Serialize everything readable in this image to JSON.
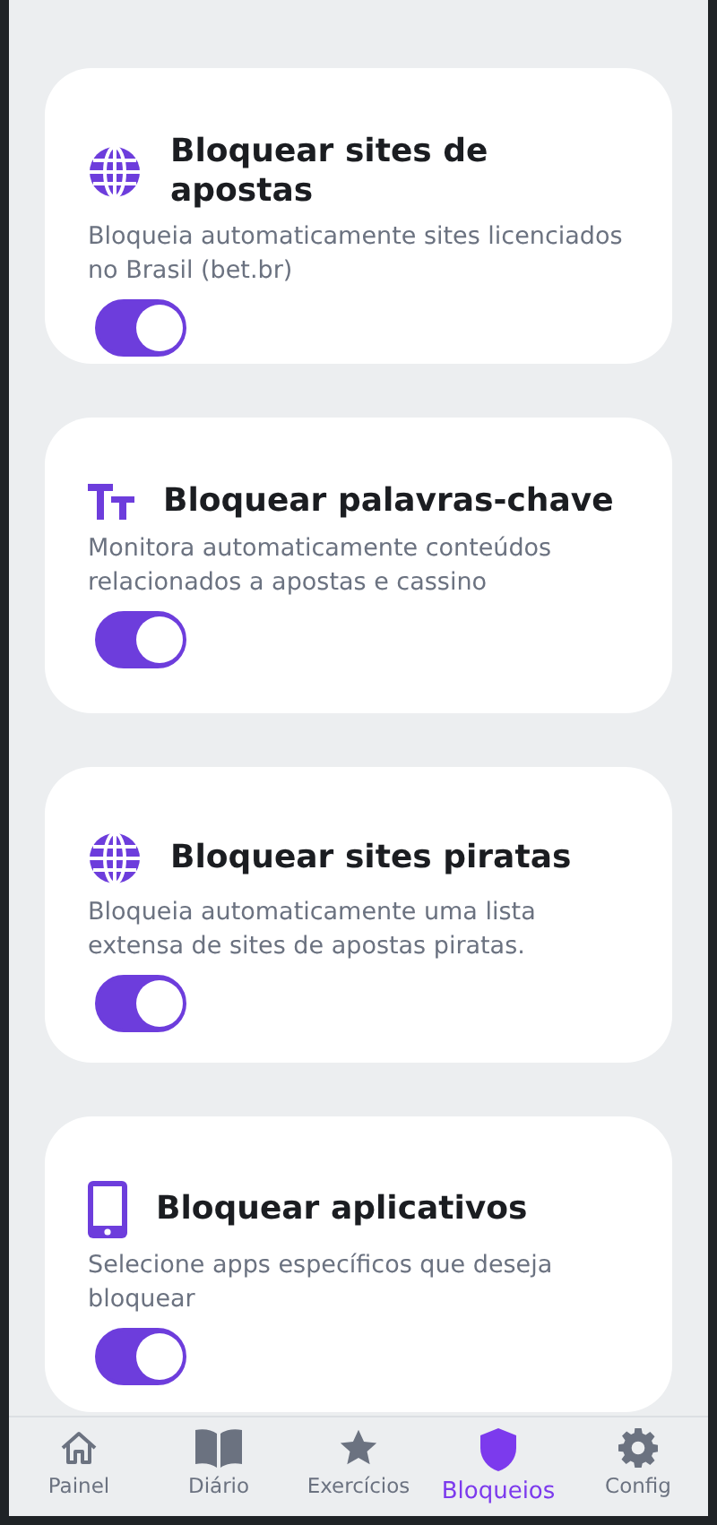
{
  "cards": [
    {
      "kind": "globe",
      "title": "Bloquear sites de apostas",
      "description": "Bloqueia automaticamente sites licenciados no Brasil (bet.br)",
      "on": true
    },
    {
      "kind": "text",
      "title": "Bloquear palavras-chave",
      "description": "Monitora automaticamente conteúdos relacionados a apostas e cassino",
      "on": true
    },
    {
      "kind": "globe",
      "title": "Bloquear sites piratas",
      "description": "Bloqueia automaticamente uma lista extensa de sites de apostas piratas.",
      "on": true
    },
    {
      "kind": "phone",
      "title": "Bloquear aplicativos",
      "description": "Selecione apps específicos que deseja bloquear",
      "on": true
    }
  ],
  "nav": [
    {
      "kind": "home",
      "label": "Painel",
      "selected": false
    },
    {
      "kind": "book",
      "label": "Diário",
      "selected": false
    },
    {
      "kind": "star",
      "label": "Exercícios",
      "selected": false
    },
    {
      "kind": "shield",
      "label": "Bloqueios",
      "selected": true
    },
    {
      "kind": "gear",
      "label": "Config",
      "selected": false
    }
  ]
}
